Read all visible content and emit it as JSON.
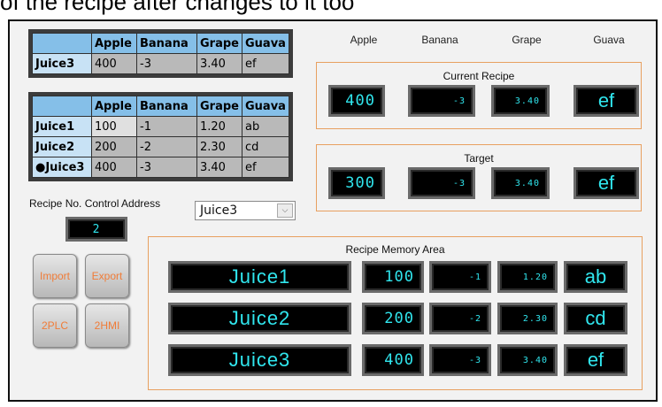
{
  "caption": "of the recipe after changes to it too",
  "top_table": {
    "columns": [
      "Apple",
      "Banana",
      "Grape",
      "Guava"
    ],
    "row": {
      "name": "Juice3",
      "values": [
        "400",
        "-3",
        "3.40",
        "ef"
      ]
    }
  },
  "main_table": {
    "columns": [
      "Apple",
      "Banana",
      "Grape",
      "Guava"
    ],
    "rows": [
      {
        "name": "Juice1",
        "values": [
          "100",
          "-1",
          "1.20",
          "ab"
        ]
      },
      {
        "name": "Juice2",
        "values": [
          "200",
          "-2",
          "2.30",
          "cd"
        ]
      },
      {
        "name": "●Juice3",
        "values": [
          "400",
          "-3",
          "3.40",
          "ef"
        ]
      }
    ]
  },
  "column_headers": [
    "Apple",
    "Banana",
    "Grape",
    "Guava"
  ],
  "current_recipe": {
    "title": "Current Recipe",
    "values": [
      "400",
      "-3",
      "3.40",
      "ef"
    ]
  },
  "target": {
    "title": "Target",
    "values": [
      "300",
      "-3",
      "3.40",
      "ef"
    ]
  },
  "control_address": {
    "label": "Recipe No. Control Address",
    "value": "2"
  },
  "recipe_select": {
    "value": "Juice3"
  },
  "buttons": {
    "import": "Import",
    "export": "Export",
    "to_plc": "2PLC",
    "to_hmi": "2HMI"
  },
  "memory_area": {
    "title": "Recipe Memory Area",
    "rows": [
      {
        "name": "Juice1",
        "values": [
          "100",
          "-1",
          "1.20",
          "ab"
        ]
      },
      {
        "name": "Juice2",
        "values": [
          "200",
          "-2",
          "2.30",
          "cd"
        ]
      },
      {
        "name": "Juice3",
        "values": [
          "400",
          "-3",
          "3.40",
          "ef"
        ]
      }
    ]
  },
  "colors": {
    "accent_border": "#e8a060",
    "display_text": "#30e6ee",
    "table_header": "#85bfe8",
    "button_text": "#f07c38"
  },
  "icons": {
    "dropdown": "chevron-down-icon"
  }
}
